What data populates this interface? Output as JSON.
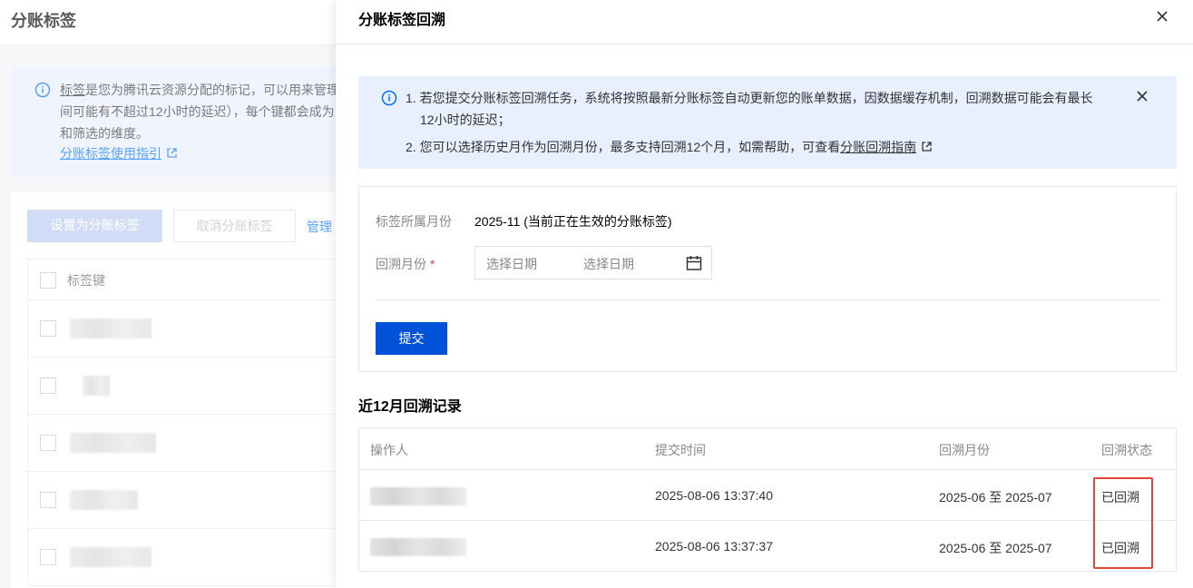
{
  "background": {
    "page_title": "分账标签",
    "notice": {
      "link_word": "标签",
      "text_rest": "是您为腾讯云资源分配的标记，可以用来管理",
      "line2": "间可能有不超过12小时的延迟），每个键都会成为",
      "line3": "和筛选的维度。",
      "guide_link": "分账标签使用指引"
    },
    "toolbar": {
      "set_button": "设置为分账标签",
      "cancel_button": "取消分账标签",
      "manage_link": "管理"
    },
    "table": {
      "column_key": "标签键"
    }
  },
  "drawer": {
    "title": "分账标签回溯",
    "notice": {
      "line1": "1. 若您提交分账标签回溯任务，系统将按照最新分账标签自动更新您的账单数据，因数据缓存机制，回溯数据可能会有最长",
      "line1b": "12小时的延迟；",
      "line2_prefix": "2. 您可以选择历史月作为回溯月份，最多支持回溯12个月，如需帮助，可查看",
      "line2_link": "分账回溯指南"
    },
    "form": {
      "month_label": "标签所属月份",
      "month_value": "2025-11 (当前正在生效的分账标签)",
      "backtrack_label": "回溯月份",
      "required_mark": "*",
      "start_placeholder": "选择日期",
      "end_placeholder": "选择日期",
      "submit_label": "提交"
    },
    "records": {
      "section_title": "近12月回溯记录",
      "columns": [
        "操作人",
        "提交时间",
        "回溯月份",
        "回溯状态"
      ],
      "rows": [
        {
          "submit_time": "2025-08-06 13:37:40",
          "months": "2025-06 至 2025-07",
          "status": "已回溯"
        },
        {
          "submit_time": "2025-08-06 13:37:37",
          "months": "2025-06 至 2025-07",
          "status": "已回溯"
        }
      ]
    }
  },
  "colors": {
    "primary": "#0052d9",
    "notice_bg": "#e8efff",
    "highlight": "#e0473a"
  },
  "icons": [
    "info-icon",
    "external-link-icon",
    "close-icon",
    "calendar-icon"
  ]
}
